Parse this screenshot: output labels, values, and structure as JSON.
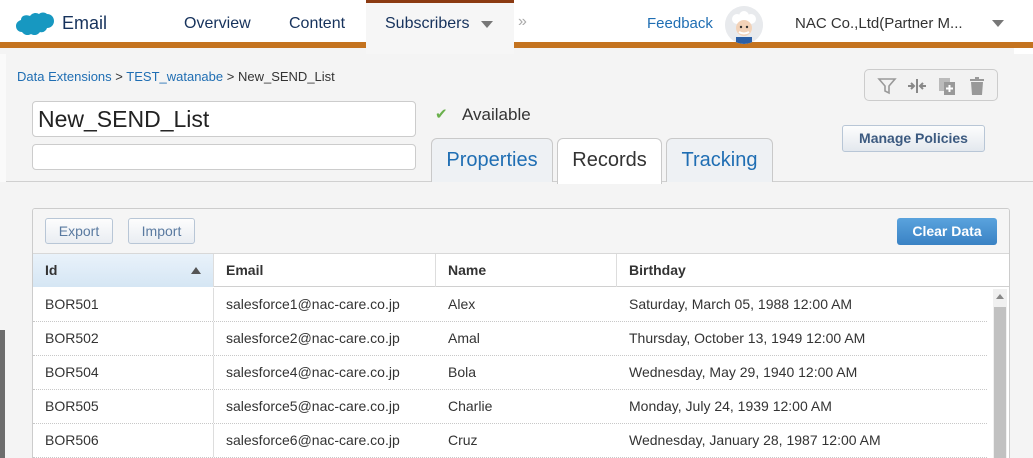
{
  "nav": {
    "app_name": "Email",
    "tabs": [
      "Overview",
      "Content",
      "Subscribers"
    ],
    "more": "»",
    "feedback": "Feedback",
    "account": "NAC Co.,Ltd(Partner M..."
  },
  "breadcrumb": {
    "items": [
      "Data Extensions",
      "TEST_watanabe"
    ],
    "separator": ">",
    "current": "New_SEND_List"
  },
  "data_extension": {
    "name": "New_SEND_List",
    "description": "",
    "status": "Available"
  },
  "detail_tabs": [
    "Properties",
    "Records",
    "Tracking"
  ],
  "toolbar_icons": [
    "filter-icon",
    "split-icon",
    "copy-add-icon",
    "trash-icon"
  ],
  "manage_policies": "Manage Policies",
  "records": {
    "export_label": "Export",
    "import_label": "Import",
    "clear_label": "Clear Data",
    "columns": [
      "Id",
      "Email",
      "Name",
      "Birthday"
    ],
    "sorted_column": "Id",
    "rows": [
      [
        "BOR501",
        "salesforce1@nac-care.co.jp",
        "Alex",
        "Saturday, March 05, 1988 12:00 AM"
      ],
      [
        "BOR502",
        "salesforce2@nac-care.co.jp",
        "Amal",
        "Thursday, October 13, 1949 12:00 AM"
      ],
      [
        "BOR504",
        "salesforce4@nac-care.co.jp",
        "Bola",
        "Wednesday, May 29, 1940 12:00 AM"
      ],
      [
        "BOR505",
        "salesforce5@nac-care.co.jp",
        "Charlie",
        "Monday, July 24, 1939 12:00 AM"
      ],
      [
        "BOR506",
        "salesforce6@nac-care.co.jp",
        "Cruz",
        "Wednesday, January 28, 1987 12:00 AM"
      ]
    ]
  },
  "colors": {
    "nav_underline": "#c4731f",
    "active_tab_top": "#8b3a12",
    "link": "#1f6eb3",
    "primary_button": "#3a82c4",
    "check": "#6ab04c"
  }
}
